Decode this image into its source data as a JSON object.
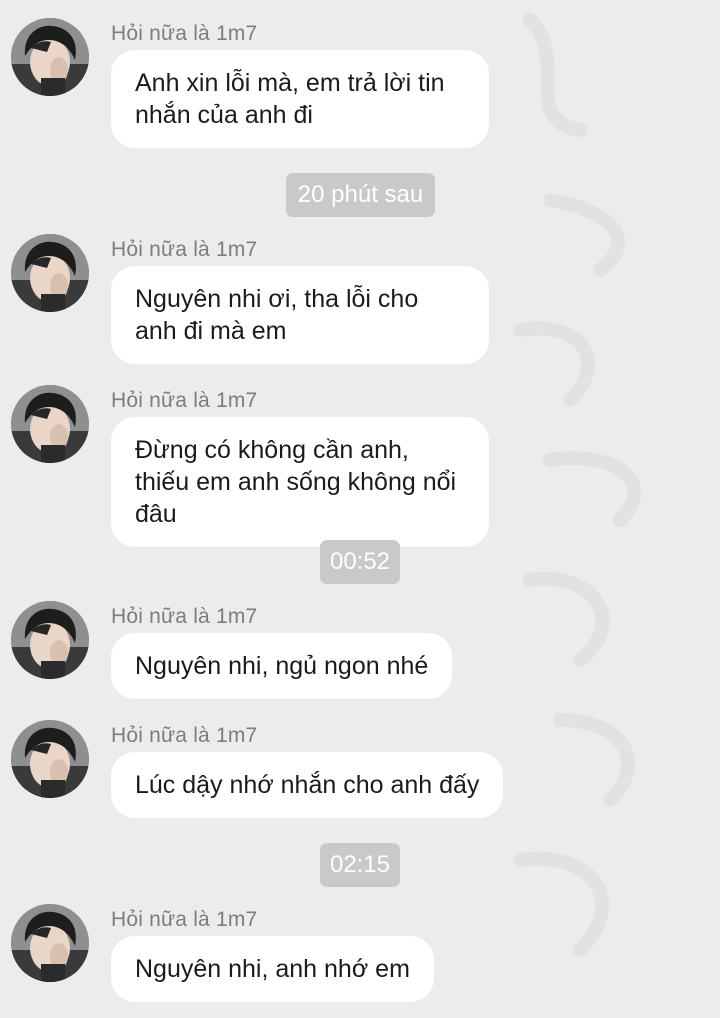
{
  "sender_name": "Hỏi nữa là 1m7",
  "messages": [
    {
      "sender": "Hỏi nữa là 1m7",
      "text": "Anh xin lỗi mà, em trả lời tin nhắn của anh đi"
    },
    {
      "sender": "Hỏi nữa là 1m7",
      "text": "Nguyên nhi ơi, tha lỗi cho anh đi mà em"
    },
    {
      "sender": "Hỏi nữa là 1m7",
      "text": "Đừng có không cần anh, thiếu em anh sống không nổi đâu"
    },
    {
      "sender": "Hỏi nữa là 1m7",
      "text": "Nguyên nhi, ngủ ngon nhé"
    },
    {
      "sender": "Hỏi nữa là 1m7",
      "text": "Lúc dậy nhớ nhắn cho anh đấy"
    },
    {
      "sender": "Hỏi nữa là 1m7",
      "text": "Nguyên nhi, anh nhớ em"
    }
  ],
  "timestamps": [
    "20 phút sau",
    "00:52",
    "02:15"
  ],
  "colors": {
    "background": "#ececec",
    "bubble": "#ffffff",
    "timestamp_pill": "#c9c9c9",
    "sender_name": "#7d7d7d"
  }
}
